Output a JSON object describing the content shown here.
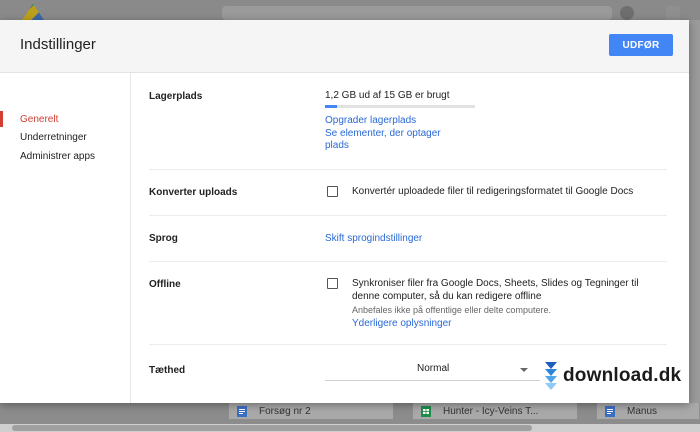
{
  "dialog": {
    "title": "Indstillinger",
    "done_label": "UDFØR"
  },
  "sidebar": {
    "items": [
      {
        "label": "Generelt",
        "active": true
      },
      {
        "label": "Underretninger",
        "active": false
      },
      {
        "label": "Administrer apps",
        "active": false
      }
    ]
  },
  "settings": {
    "storage": {
      "label": "Lagerplads",
      "usage_text": "1,2 GB ud af 15 GB er brugt",
      "usage_fraction": 0.08,
      "upgrade_link": "Opgrader lagerplads",
      "items_link_line1": "Se elementer, der optager",
      "items_link_line2": "plads"
    },
    "convert": {
      "label": "Konverter uploads",
      "checkbox_text": "Konvertér uploadede filer til redigeringsformatet til Google Docs",
      "checked": false
    },
    "language": {
      "label": "Sprog",
      "link": "Skift sprogindstillinger"
    },
    "offline": {
      "label": "Offline",
      "checkbox_line1": "Synkroniser filer fra Google Docs, Sheets, Slides og Tegninger til",
      "checkbox_line2": "denne computer, så du kan redigere offline",
      "note": "Anbefales ikke på offentlige eller delte computere.",
      "more_link": "Yderligere oplysninger",
      "checked": false
    },
    "density": {
      "label": "Tæthed",
      "selected": "Normal"
    }
  },
  "background": {
    "files": [
      {
        "name": "Forsøg nr 2",
        "icon": "docs-icon"
      },
      {
        "name": "Hunter - Icy-Veins T...",
        "icon": "sheets-icon"
      },
      {
        "name": "Manus",
        "icon": "docs-icon"
      }
    ]
  },
  "watermark": {
    "text": "download.dk"
  },
  "colors": {
    "accent": "#4285f4",
    "active_nav": "#d23f31",
    "link": "#2a69d6"
  }
}
